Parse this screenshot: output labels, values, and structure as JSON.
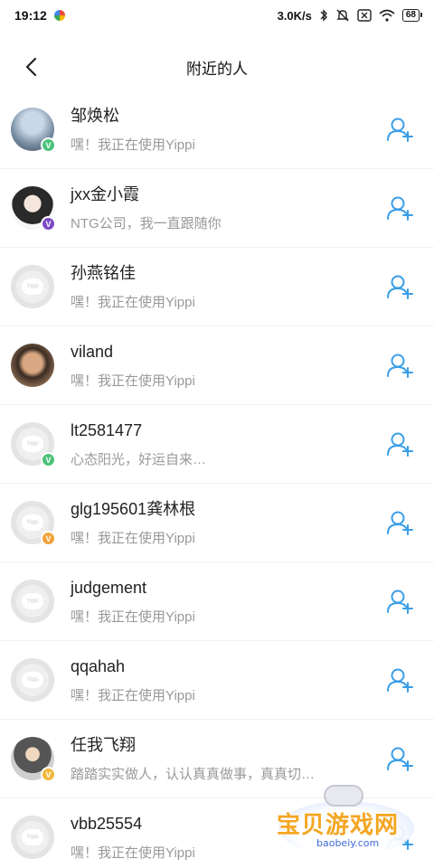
{
  "status": {
    "time": "19:12",
    "speed": "3.0K/s",
    "battery": "68"
  },
  "nav": {
    "title": "附近的人"
  },
  "users": [
    {
      "name": "邹焕松",
      "desc": "嘿！我正在使用Yippi",
      "avatar": "photo1",
      "badge": "green",
      "badge_letter": "V"
    },
    {
      "name": "jxx金小霞",
      "desc": "NTG公司，我一直跟随你",
      "avatar": "photo2",
      "badge": "purple",
      "badge_letter": "V"
    },
    {
      "name": "孙燕铭佳",
      "desc": "嘿！我正在使用Yippi",
      "avatar": "default",
      "badge": "",
      "badge_letter": ""
    },
    {
      "name": "viland",
      "desc": "嘿！我正在使用Yippi",
      "avatar": "photo3",
      "badge": "",
      "badge_letter": ""
    },
    {
      "name": "lt2581477",
      "desc": "心态阳光，好运自来…",
      "avatar": "default",
      "badge": "green",
      "badge_letter": "V"
    },
    {
      "name": "glg195601龚林根",
      "desc": "嘿！我正在使用Yippi",
      "avatar": "default",
      "badge": "orange",
      "badge_letter": "V"
    },
    {
      "name": "judgement",
      "desc": "嘿！我正在使用Yippi",
      "avatar": "default",
      "badge": "",
      "badge_letter": ""
    },
    {
      "name": "qqahah",
      "desc": "嘿！我正在使用Yippi",
      "avatar": "default",
      "badge": "",
      "badge_letter": ""
    },
    {
      "name": "任我飞翔",
      "desc": "踏踏实实做人，认认真真做事，真真切…",
      "avatar": "photo4",
      "badge": "yellow",
      "badge_letter": "V"
    },
    {
      "name": "vbb25554",
      "desc": "嘿！我正在使用Yippi",
      "avatar": "default",
      "badge": "",
      "badge_letter": ""
    }
  ],
  "avatar_placeholder_text": "Yippi",
  "watermark": {
    "text": "宝贝游戏网",
    "url": "baobeiy.com"
  },
  "colors": {
    "accent": "#3a9ee8",
    "secondary_text": "#999999"
  }
}
